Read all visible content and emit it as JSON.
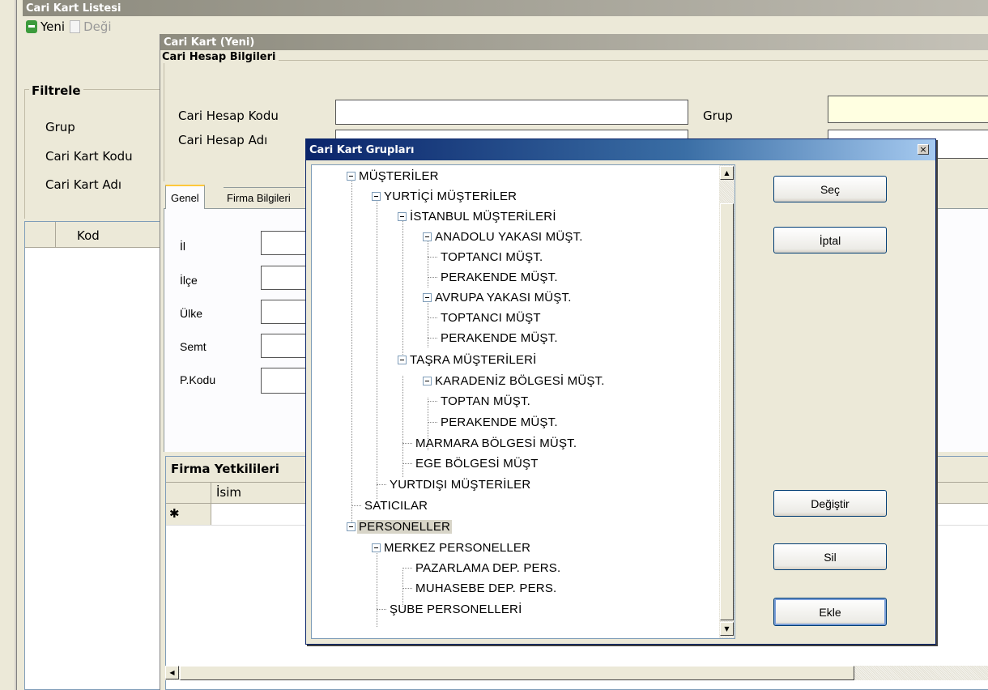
{
  "list_window": {
    "title": "Cari Kart Listesi",
    "toolbar": {
      "new_label": "Yeni",
      "edit_label": "Deği"
    },
    "filter_title": "Filtrele",
    "filter_labels": [
      "Grup",
      "Cari Kart Kodu",
      "Cari Kart Adı"
    ],
    "grid_header": "Kod"
  },
  "card_window": {
    "title": "Cari Kart (Yeni)",
    "section_title": "Cari Hesap Bilgileri",
    "account_code_label": "Cari Hesap Kodu",
    "account_name_label": "Cari Hesap Adı",
    "group_label": "Grup",
    "tabs": [
      "Genel",
      "Firma Bilgileri"
    ],
    "address_labels": [
      "İl",
      "İlçe",
      "Ülke",
      "Semt",
      "P.Kodu"
    ],
    "contacts_title": "Firma Yetkilileri",
    "contacts_header": "İsim",
    "new_row_marker": "✱"
  },
  "groups_dialog": {
    "title": "Cari Kart Grupları",
    "close_label": "×",
    "buttons": {
      "select": "Seç",
      "cancel": "İptal",
      "change": "Değiştir",
      "delete": "Sil",
      "add": "Ekle"
    },
    "tree": [
      "MÜŞTERİLER",
      "YURTİÇİ MÜŞTERİLER",
      "İSTANBUL MÜŞTERİLERİ",
      "ANADOLU YAKASI MÜŞT.",
      "TOPTANCI MÜŞT.",
      "PERAKENDE MÜŞT.",
      "AVRUPA YAKASI MÜŞT.",
      "TOPTANCI MÜŞT",
      "PERAKENDE MÜŞT.",
      "TAŞRA MÜŞTERİLERİ",
      "KARADENİZ BÖLGESİ MÜŞT.",
      "TOPTAN MÜŞT.",
      "PERAKENDE MÜŞT.",
      "MARMARA BÖLGESİ MÜŞT.",
      "EGE BÖLGESİ MÜŞT",
      "YURTDIŞI MÜŞTERİLER",
      "SATICILAR",
      "PERSONELLER",
      "MERKEZ PERSONELLER",
      "PAZARLAMA DEP. PERS.",
      "MUHASEBE DEP. PERS.",
      "ŞUBE PERSONELLERİ"
    ],
    "selected_item": "PERSONELLER"
  },
  "colors": {
    "inactive_title": "#8d8b7e",
    "active_title": "#0a246a",
    "group_field": "#ffffe1"
  }
}
